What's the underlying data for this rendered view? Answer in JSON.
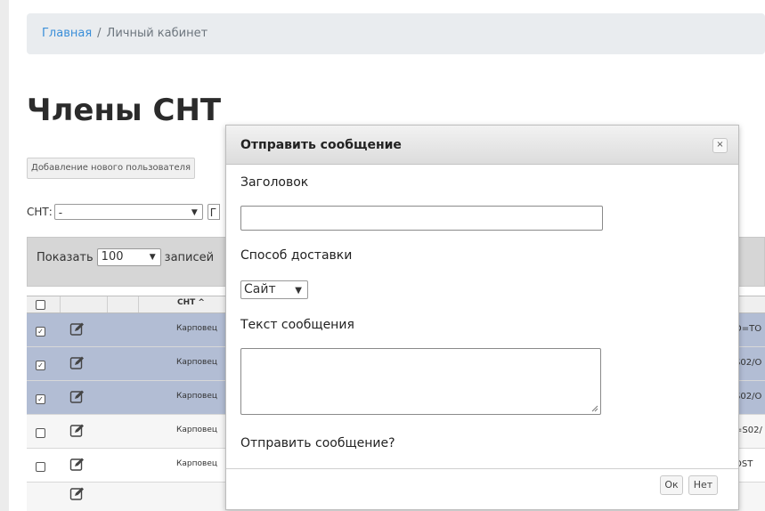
{
  "breadcrumb": {
    "home": "Главная",
    "separator": "/",
    "current": "Личный кабинет"
  },
  "page_title": "Члены СНТ",
  "add_user_label": "Добавление нового пользователя",
  "filter": {
    "label": "СНТ:",
    "value": "-",
    "button_label": "Г"
  },
  "table_length": {
    "show_label": "Показать",
    "value": "100",
    "records_label": "записей"
  },
  "table": {
    "header": {
      "snt": "СНТ",
      "sort": "^"
    },
    "rows": [
      {
        "selected": true,
        "snt": "Карповец",
        "tail": "D=TO"
      },
      {
        "selected": true,
        "snt": "Карповец",
        "tail": "S02/O"
      },
      {
        "selected": true,
        "snt": "Карповец",
        "tail": "S02/O"
      },
      {
        "selected": false,
        "snt": "Карповец",
        "tail": "=S02/"
      },
      {
        "selected": false,
        "snt": "Карповец",
        "tail": "OST"
      }
    ]
  },
  "modal": {
    "title": "Отправить сообщение",
    "close_symbol": "×",
    "subject_label": "Заголовок",
    "subject_value": "",
    "delivery_label": "Способ доставки",
    "delivery_value": "Сайт",
    "message_label": "Текст сообщения",
    "message_value": "",
    "confirm_text": "Отправить сообщение?",
    "ok_label": "Ок",
    "no_label": "Нет"
  },
  "colors": {
    "selected_row": "#b2bdd4",
    "link": "#3b8fd9"
  }
}
